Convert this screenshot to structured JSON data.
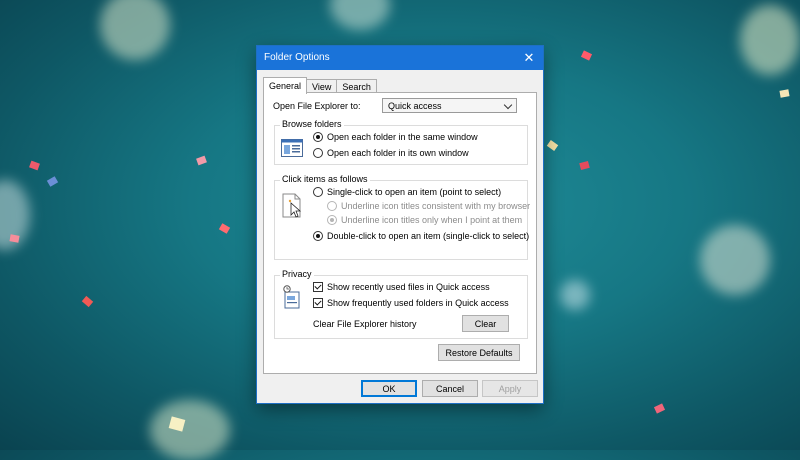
{
  "window": {
    "title": "Folder Options"
  },
  "tabs": [
    {
      "label": "General",
      "active": true
    },
    {
      "label": "View",
      "active": false
    },
    {
      "label": "Search",
      "active": false
    }
  ],
  "open_explorer": {
    "label": "Open File Explorer to:",
    "value": "Quick access"
  },
  "browse": {
    "legend": "Browse folders",
    "options": [
      {
        "label": "Open each folder in the same window",
        "selected": true
      },
      {
        "label": "Open each folder in its own window",
        "selected": false
      }
    ]
  },
  "click": {
    "legend": "Click items as follows",
    "single": {
      "label": "Single-click to open an item (point to select)",
      "selected": false
    },
    "underline_all": {
      "label": "Underline icon titles consistent with my browser",
      "selected": false
    },
    "underline_point": {
      "label": "Underline icon titles only when I point at them",
      "selected": true
    },
    "double": {
      "label": "Double-click to open an item (single-click to select)",
      "selected": true
    }
  },
  "privacy": {
    "legend": "Privacy",
    "recent_files": {
      "label": "Show recently used files in Quick access",
      "checked": true
    },
    "frequent_folders": {
      "label": "Show frequently used folders in Quick access",
      "checked": true
    },
    "clear_label": "Clear File Explorer history",
    "clear_button": "Clear"
  },
  "restore_defaults": "Restore Defaults",
  "footer": {
    "ok": "OK",
    "cancel": "Cancel",
    "apply": "Apply"
  },
  "colors": {
    "title_bar": "#1a73d9",
    "desktop": "#167784"
  }
}
